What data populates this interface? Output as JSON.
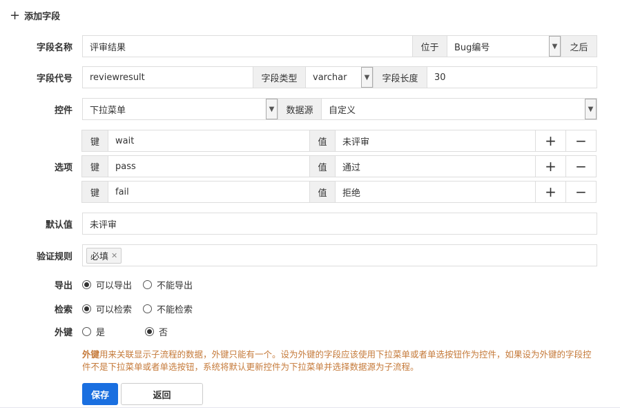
{
  "title": "添加字段",
  "fields": {
    "name": {
      "label": "字段名称",
      "value": "评审结果",
      "pos_label": "位于",
      "pos_value": "Bug编号",
      "after": "之后"
    },
    "code": {
      "label": "字段代号",
      "value": "reviewresult",
      "type_label": "字段类型",
      "type_value": "varchar",
      "len_label": "字段长度",
      "len_value": "30"
    },
    "control": {
      "label": "控件",
      "value": "下拉菜单",
      "source_label": "数据源",
      "source_value": "自定义"
    },
    "options": {
      "label": "选项",
      "key_label": "键",
      "val_label": "值",
      "add": "+",
      "remove": "−",
      "items": [
        {
          "key": "wait",
          "value": "未评审"
        },
        {
          "key": "pass",
          "value": "通过"
        },
        {
          "key": "fail",
          "value": "拒绝"
        }
      ]
    },
    "default": {
      "label": "默认值",
      "value": "未评审"
    },
    "rules": {
      "label": "验证规则",
      "tag": "必填",
      "tag_close": "✕"
    },
    "export": {
      "label": "导出",
      "opt1": "可以导出",
      "opt2": "不能导出"
    },
    "search": {
      "label": "检索",
      "opt1": "可以检索",
      "opt2": "不能检索"
    },
    "fk": {
      "label": "外键",
      "opt1": "是",
      "opt2": "否"
    }
  },
  "note": {
    "bold": "外键",
    "text": "用来关联显示子流程的数据，外键只能有一个。设为外键的字段应该使用下拉菜单或者单选按钮作为控件，如果设为外键的字段控件不是下拉菜单或者单选按钮，系统将默认更新控件为下拉菜单并选择数据源为子流程。"
  },
  "buttons": {
    "save": "保存",
    "back": "返回"
  }
}
